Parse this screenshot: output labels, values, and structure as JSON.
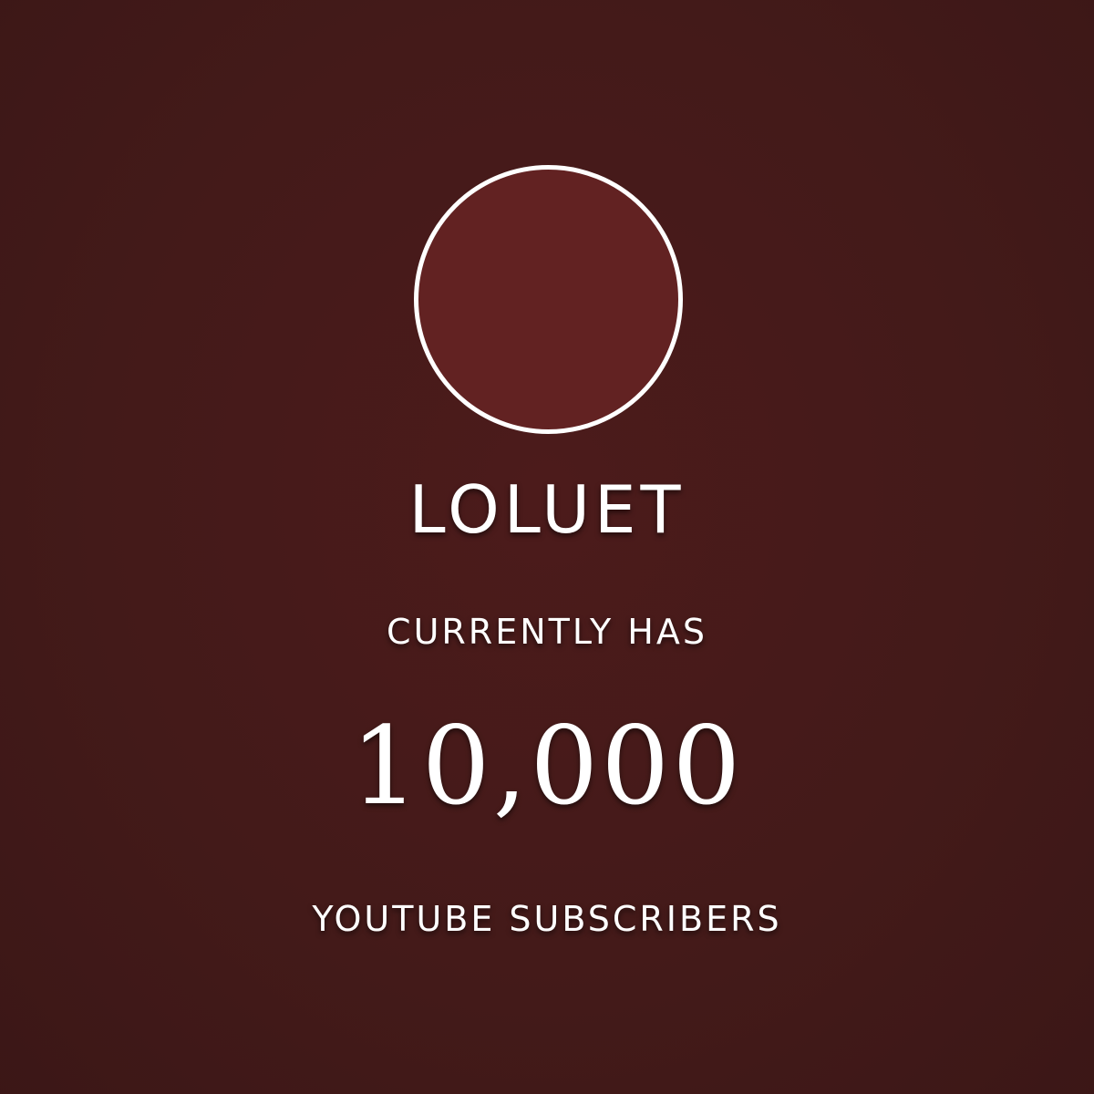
{
  "channel": {
    "name": "LOLUET",
    "avatar_color": "#622222"
  },
  "milestone": {
    "prefix": "CURRENTLY HAS",
    "count": "10,000",
    "suffix": "YOUTUBE SUBSCRIBERS"
  },
  "colors": {
    "background": "#431a19",
    "text": "#ffffff"
  }
}
